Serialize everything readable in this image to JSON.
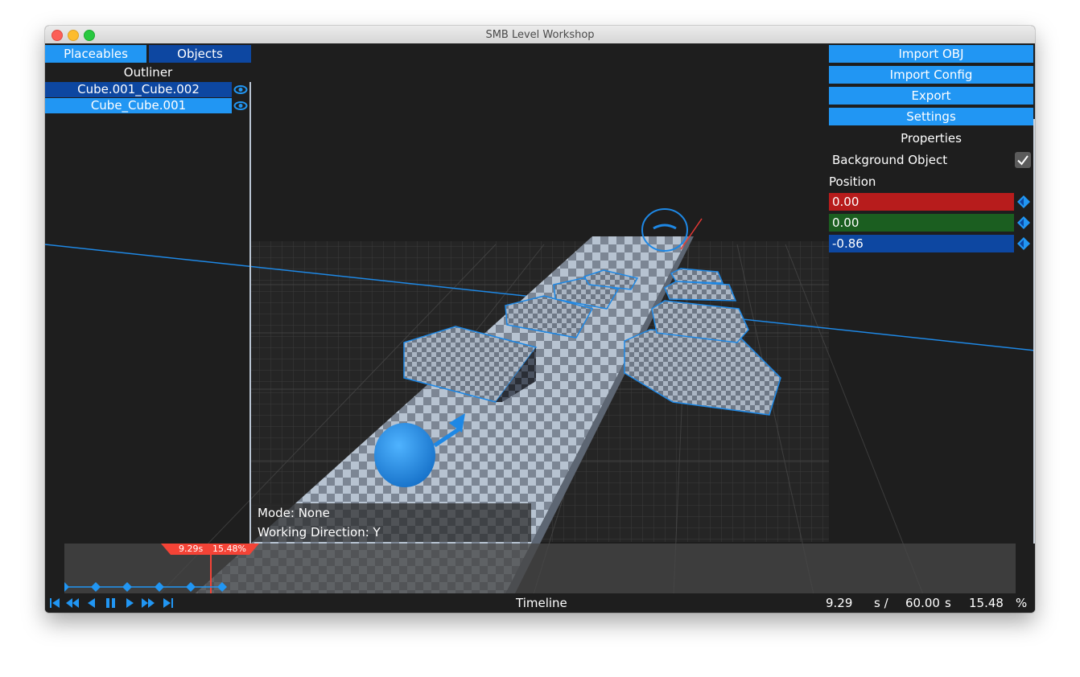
{
  "window": {
    "title": "SMB Level Workshop"
  },
  "left_panel": {
    "tabs": [
      {
        "label": "Placeables",
        "active": true
      },
      {
        "label": "Objects",
        "active": false
      }
    ],
    "outliner_title": "Outliner",
    "items": [
      {
        "name": "Cube.001_Cube.002",
        "selected": true
      },
      {
        "name": "Cube_Cube.001",
        "selected": false
      }
    ]
  },
  "right_panel": {
    "buttons": [
      "Import OBJ",
      "Import Config",
      "Export",
      "Settings"
    ],
    "properties_title": "Properties",
    "background_object_label": "Background Object",
    "background_object_checked": true,
    "position_label": "Position",
    "position": {
      "x": "0.00",
      "y": "0.00",
      "z": "-0.86"
    }
  },
  "viewport": {
    "mode_text": "Mode: None",
    "working_direction_text": "Working Direction: Y"
  },
  "timeline": {
    "playhead_time": "9.29s",
    "playhead_percent": "15.48%",
    "label": "Timeline",
    "current_time": "9.29",
    "unit_s_slash": "s /",
    "total_time": "60.00",
    "unit_s": "s",
    "percent": "15.48",
    "percent_sign": "%",
    "keyframe_count": 6
  },
  "colors": {
    "accent": "#2196f3",
    "accent_dark": "#0d47a1",
    "x_axis": "#b71c1c",
    "y_axis": "#1b5e20",
    "z_axis": "#0d47a1",
    "playhead": "#f44336"
  },
  "icons": {
    "visibility": "eye-icon",
    "checkbox": "checkmark-icon",
    "keyframe": "diamond-keyframe-icon",
    "transport": [
      "skip-to-start-icon",
      "rewind-icon",
      "play-reverse-icon",
      "pause-icon",
      "play-icon",
      "fast-forward-icon",
      "skip-to-end-icon"
    ]
  }
}
